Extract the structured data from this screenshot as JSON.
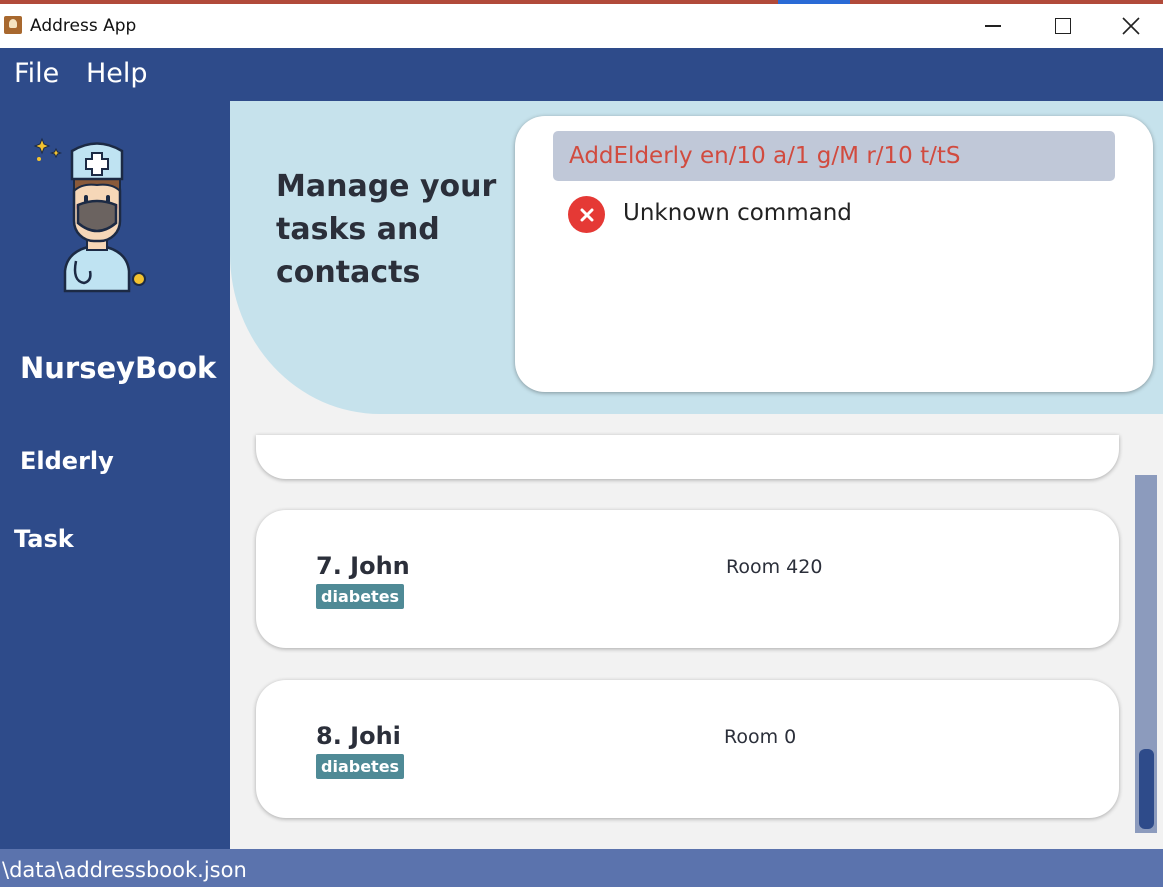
{
  "window": {
    "title": "Address App"
  },
  "menu": {
    "file": "File",
    "help": "Help"
  },
  "sidebar": {
    "brand": "NurseyBook",
    "items": [
      {
        "label": "Elderly"
      },
      {
        "label": "Task"
      }
    ]
  },
  "hero": {
    "text": "Manage your\ntasks and\ncontacts"
  },
  "command": {
    "input_value": "AddElderly en/10 a/1 g/M r/10 t/tS",
    "result": "Unknown command"
  },
  "list": {
    "cards": [
      {
        "name": "7. John",
        "tag": "diabetes",
        "room": "Room 420"
      },
      {
        "name": "8. Johi",
        "tag": "diabetes",
        "room": "Room 0"
      }
    ]
  },
  "status": {
    "path": "\\data\\addressbook.json"
  },
  "colors": {
    "primary": "#2e4b8a",
    "hero": "#c6e2ec",
    "error": "#e53935",
    "tag": "#4f8a96"
  },
  "icons": [
    "app-icon",
    "minimize-icon",
    "maximize-icon",
    "close-icon",
    "nurse-avatar-icon",
    "error-icon"
  ]
}
